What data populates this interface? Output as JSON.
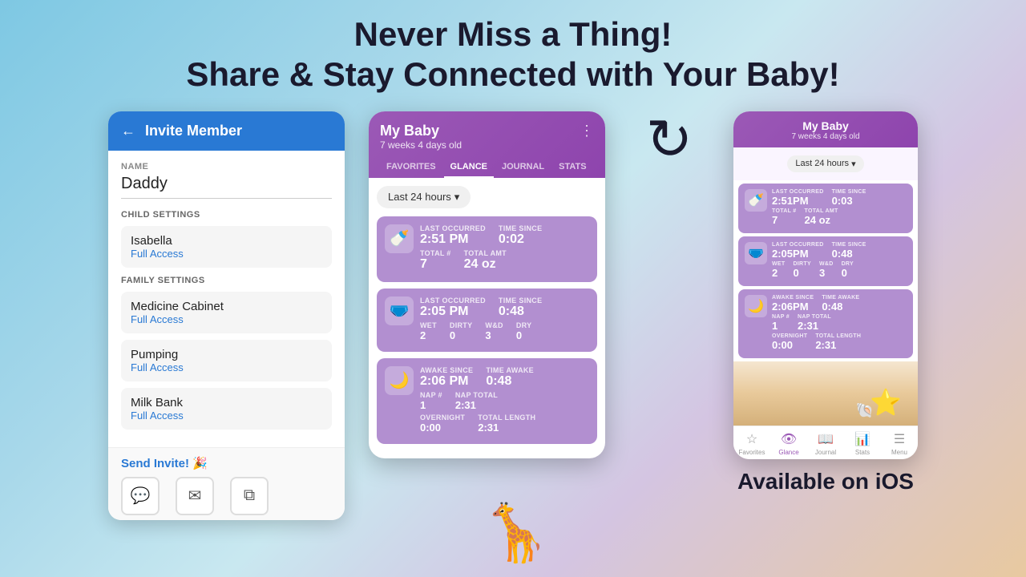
{
  "header": {
    "line1": "Never Miss a Thing!",
    "line2": "Share & Stay Connected with Your Baby!"
  },
  "left_panel": {
    "title": "Invite Member",
    "name_label": "NAME",
    "name_value": "Daddy",
    "child_settings_label": "CHILD SETTINGS",
    "child_item": {
      "name": "Isabella",
      "access": "Full Access"
    },
    "family_settings_label": "FAMILY SETTINGS",
    "family_items": [
      {
        "name": "Medicine Cabinet",
        "access": "Full Access"
      },
      {
        "name": "Pumping",
        "access": "Full Access"
      },
      {
        "name": "Milk Bank",
        "access": "Full Access"
      }
    ],
    "send_invite": "Send Invite! 🎉"
  },
  "middle_panel": {
    "baby_name": "My Baby",
    "baby_age": "7 weeks 4 days old",
    "tabs": [
      "FAVORITES",
      "GLANCE",
      "JOURNAL",
      "STATS"
    ],
    "active_tab": "GLANCE",
    "time_filter": "Last 24 hours",
    "cards": [
      {
        "icon": "🍼",
        "fields": [
          {
            "label": "LAST OCCURRED",
            "value": "2:51 PM"
          },
          {
            "label": "TIME SINCE",
            "value": "0:02"
          },
          {
            "label": "TOTAL #",
            "value": "7"
          },
          {
            "label": "TOTAL AMT",
            "value": "24 oz"
          }
        ]
      },
      {
        "icon": "👶",
        "fields": [
          {
            "label": "LAST OCCURRED",
            "value": "2:05 PM"
          },
          {
            "label": "TIME SINCE",
            "value": "0:48"
          },
          {
            "label": "WET",
            "value": "2"
          },
          {
            "label": "DIRTY",
            "value": "0"
          },
          {
            "label": "W&D",
            "value": "3"
          },
          {
            "label": "DRY",
            "value": "0"
          }
        ]
      },
      {
        "icon": "💤",
        "fields": [
          {
            "label": "AWAKE SINCE",
            "value": "2:06 PM"
          },
          {
            "label": "TIME AWAKE",
            "value": "0:48"
          },
          {
            "label": "NAP #",
            "value": "1"
          },
          {
            "label": "NAP TOTAL",
            "value": "2:31"
          },
          {
            "label": "OVERNIGHT",
            "value": "0:00"
          },
          {
            "label": "TOTAL LENGTH",
            "value": "2:31"
          }
        ]
      }
    ]
  },
  "right_panel": {
    "baby_name": "My Baby",
    "baby_age": "7 weeks 4 days old",
    "time_filter": "Last 24 hours",
    "cards": [
      {
        "icon": "🍼",
        "fields": [
          {
            "label": "LAST OCCURRED",
            "value": "2:51PM"
          },
          {
            "label": "TIME SINCE",
            "value": "0:03"
          },
          {
            "label": "TOTAL #",
            "value": "7"
          },
          {
            "label": "TOTAL AMT",
            "value": "24 oz"
          }
        ]
      },
      {
        "icon": "👶",
        "fields": [
          {
            "label": "LAST OCCURRED",
            "value": "2:05PM"
          },
          {
            "label": "TIME SINCE",
            "value": "0:48"
          },
          {
            "label": "WET",
            "value": "2"
          },
          {
            "label": "DIRTY",
            "value": "0"
          },
          {
            "label": "W&D",
            "value": "3"
          },
          {
            "label": "DRY",
            "value": "0"
          }
        ]
      },
      {
        "icon": "💤",
        "fields": [
          {
            "label": "AWAKE SINCE",
            "value": "2:06PM"
          },
          {
            "label": "TIME AWAKE",
            "value": "0:48"
          },
          {
            "label": "NAP #",
            "value": "1"
          },
          {
            "label": "NAP TOTAL",
            "value": "2:31"
          },
          {
            "label": "OVERNIGHT",
            "value": "0:00"
          },
          {
            "label": "TOTAL LENGTH",
            "value": "2:31"
          }
        ]
      }
    ],
    "tab_bar": [
      "Favorites",
      "Glance",
      "Journal",
      "Stats",
      "Menu"
    ],
    "active_tab": "Glance",
    "ios_label": "Available on iOS"
  }
}
